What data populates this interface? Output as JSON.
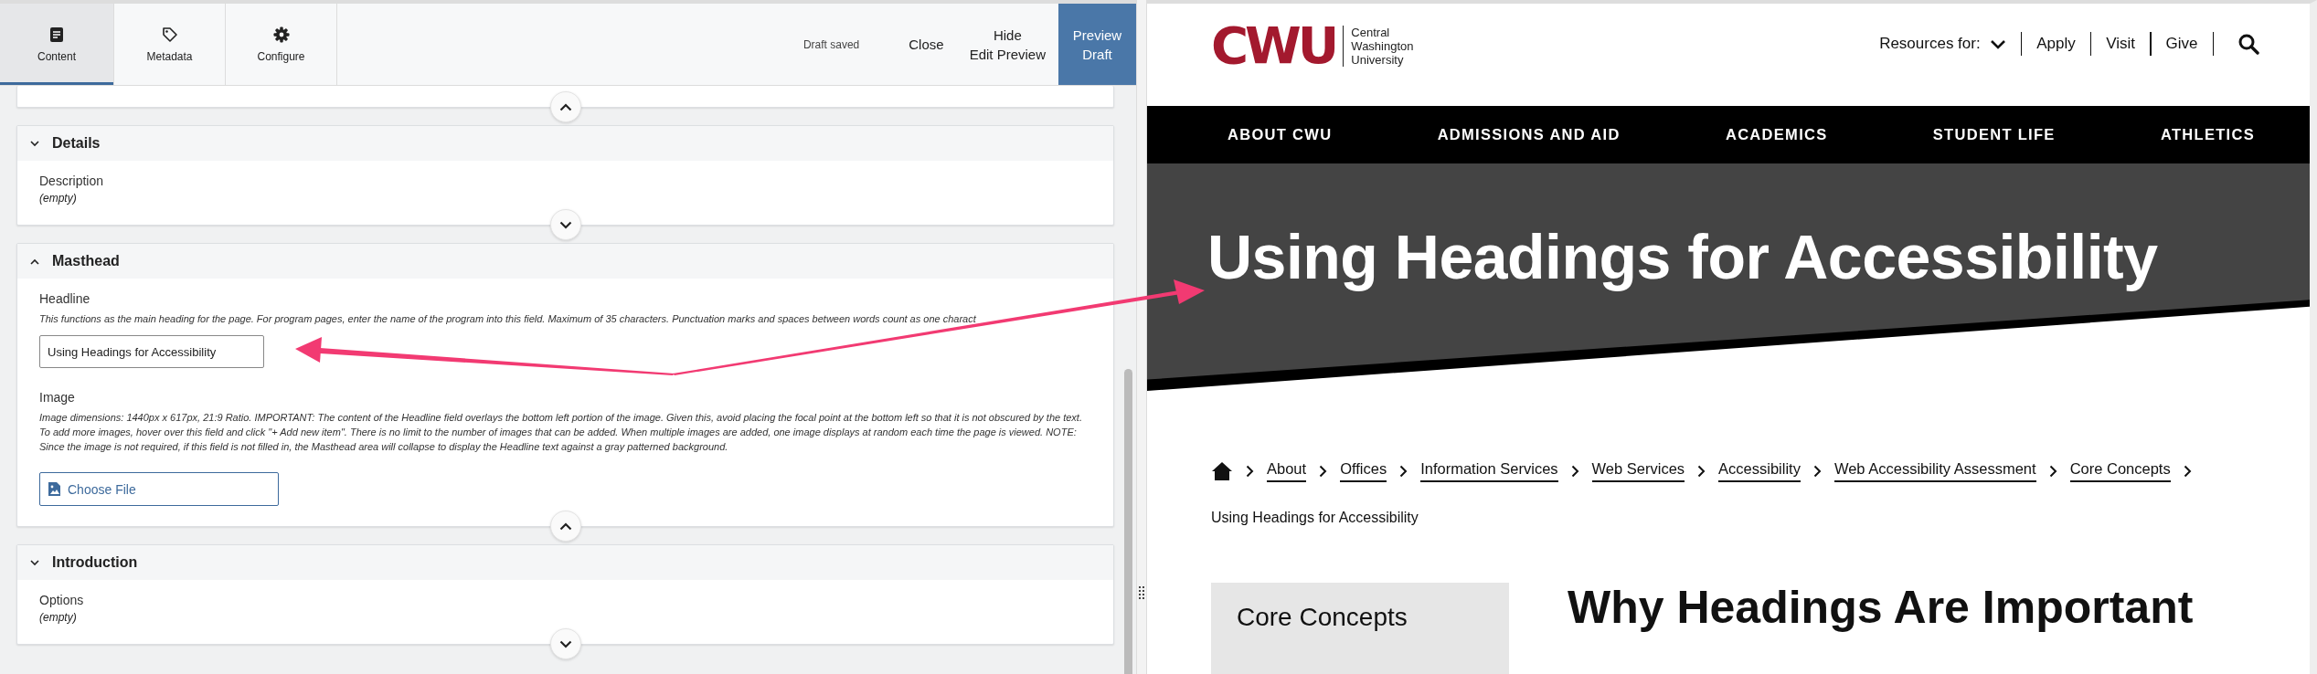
{
  "editor": {
    "tabs": [
      {
        "label": "Content",
        "kind": "document",
        "selected": true
      },
      {
        "label": "Metadata",
        "kind": "tag",
        "selected": false
      },
      {
        "label": "Configure",
        "kind": "gear",
        "selected": false
      }
    ],
    "status": "Draft saved",
    "actions": [
      {
        "kind": "plain",
        "lines": [
          "Close"
        ]
      },
      {
        "kind": "plain",
        "lines": [
          "Hide",
          "Edit Preview"
        ]
      },
      {
        "kind": "primary",
        "lines": [
          "Preview",
          "Draft"
        ]
      }
    ],
    "sections": [
      {
        "expanded": true
      },
      {
        "title": "Details",
        "expanded": false,
        "fields": [
          {
            "kind": "summary",
            "label": "Description",
            "value": "(empty)"
          }
        ]
      },
      {
        "title": "Masthead",
        "expanded": true,
        "fields": [
          {
            "kind": "text",
            "label": "Headline",
            "help": "This functions as the main heading for the page. For program pages, enter the name of the program into this field. Maximum of 35 characters. Punctuation marks and spaces between words count as one charact",
            "value": "Using Headings for Accessibility"
          },
          {
            "kind": "file",
            "label": "Image",
            "help": "Image dimensions: 1440px x 617px, 21:9 Ratio. IMPORTANT: The content of the Headline field overlays the bottom left portion of the image. Given this, avoid placing the focal point at the bottom left so that it is not obscured by the text. To add more images, hover over this field and click \"+ Add new item\". There is no limit to the number of images that can be added. When multiple images are added, one image displays at random each time the page is viewed. NOTE: Since the image is not required, if this field is not filled in, the Masthead area will collapse to display the Headline text against a gray patterned background.",
            "button": "Choose File"
          }
        ]
      },
      {
        "title": "Introduction",
        "expanded": false,
        "fields": [
          {
            "kind": "summary",
            "label": "Options",
            "value": "(empty)"
          }
        ]
      }
    ]
  },
  "preview": {
    "logo": {
      "mark": "CWU",
      "wordmark": [
        "Central",
        "Washington",
        "University"
      ]
    },
    "utility": {
      "menu": "Resources for:",
      "links": [
        "Apply",
        "Visit",
        "Give"
      ]
    },
    "nav": [
      "ABOUT CWU",
      "ADMISSIONS AND AID",
      "ACADEMICS",
      "STUDENT LIFE",
      "ATHLETICS"
    ],
    "headline": "Using Headings for Accessibility",
    "breadcrumb": [
      "About",
      "Offices",
      "Information Services",
      "Web Services",
      "Accessibility",
      "Web Accessibility Assessment",
      "Core Concepts"
    ],
    "current": "Using Headings for Accessibility",
    "sidebar_title": "Core Concepts",
    "heading": "Why Headings Are Important"
  }
}
